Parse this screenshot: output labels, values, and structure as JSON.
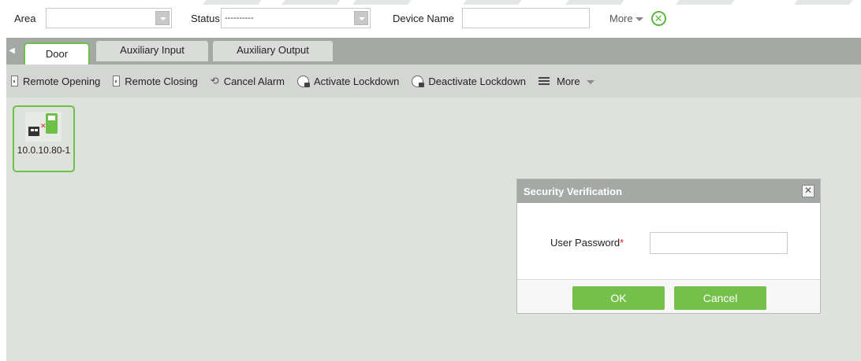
{
  "filters": {
    "area_label": "Area",
    "area_value": "",
    "status_label": "Status",
    "status_value": "----------",
    "device_name_label": "Device Name",
    "device_name_value": "",
    "more_label": "More"
  },
  "tabs": [
    {
      "label": "Door",
      "active": true
    },
    {
      "label": "Auxiliary Input",
      "active": false
    },
    {
      "label": "Auxiliary Output",
      "active": false
    }
  ],
  "actions": {
    "remote_opening": "Remote Opening",
    "remote_closing": "Remote Closing",
    "cancel_alarm": "Cancel Alarm",
    "activate_lockdown": "Activate Lockdown",
    "deactivate_lockdown": "Deactivate Lockdown",
    "more": "More"
  },
  "devices": [
    {
      "label": "10.0.10.80-1"
    }
  ],
  "dialog": {
    "title": "Security Verification",
    "password_label": "User Password",
    "required_mark": "*",
    "password_value": "",
    "ok_label": "OK",
    "cancel_label": "Cancel"
  },
  "colors": {
    "accent_green": "#6ec046",
    "button_green": "#74c04a",
    "header_gray": "#a5a9a6",
    "toolbar_gray": "#d3d6d2",
    "content_gray": "#dfe1dd",
    "required_red": "#e02020"
  }
}
